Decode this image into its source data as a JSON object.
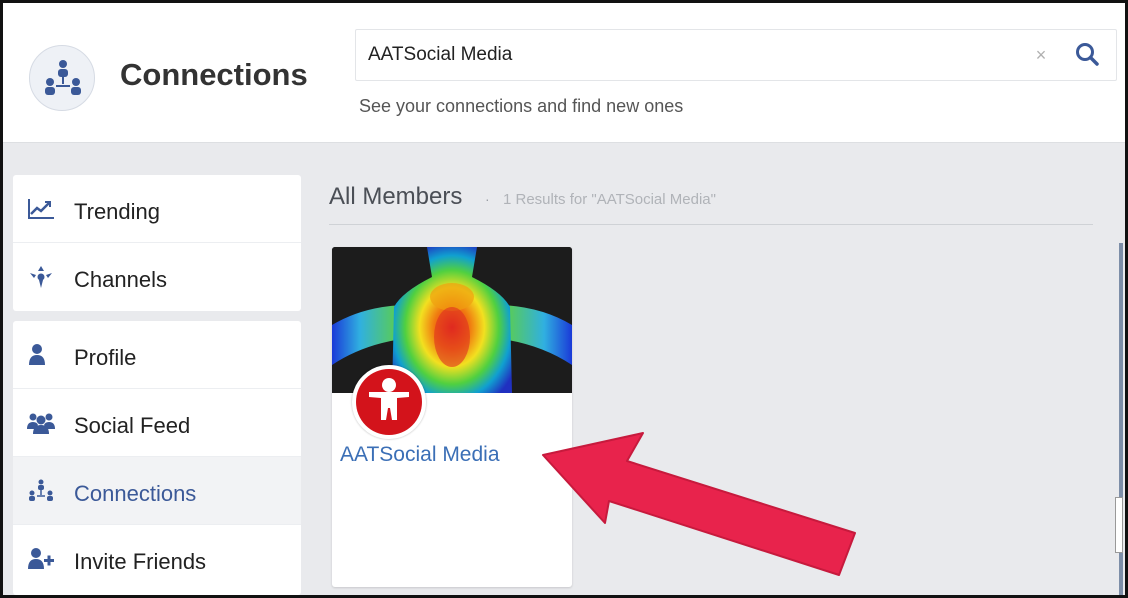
{
  "header": {
    "title": "Connections",
    "search_value": "AATSocial Media",
    "clear_icon": "×",
    "subtitle": "See your connections and find new ones"
  },
  "sidebar": {
    "group1": [
      {
        "label": "Trending",
        "icon": "trending-chart-icon"
      },
      {
        "label": "Channels",
        "icon": "channels-icon"
      }
    ],
    "group2": [
      {
        "label": "Profile",
        "icon": "user-icon"
      },
      {
        "label": "Social Feed",
        "icon": "group-icon"
      },
      {
        "label": "Connections",
        "icon": "connections-icon",
        "active": true
      },
      {
        "label": "Invite Friends",
        "icon": "add-user-icon"
      }
    ]
  },
  "main": {
    "section_title": "All Members",
    "separator": "·",
    "result_text": "1 Results for \"AATSocial Media\"",
    "member": {
      "name": "AATSocial Media"
    }
  },
  "colors": {
    "accent": "#3b5998",
    "link": "#3b6fb6",
    "arrow": "#e8234c",
    "background": "#e9eaed"
  }
}
